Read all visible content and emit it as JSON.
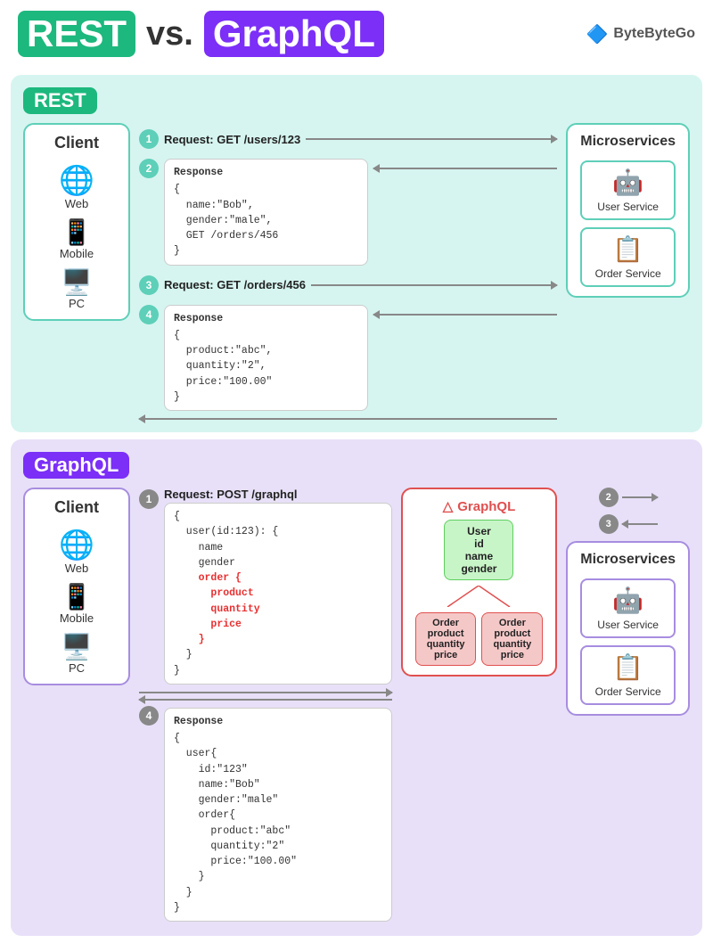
{
  "header": {
    "title_rest": "REST",
    "title_vs": "vs.",
    "title_graphql": "GraphQL",
    "brand": "ByteByteGo"
  },
  "rest": {
    "label": "REST",
    "client_title": "Client",
    "client_items": [
      "Web",
      "Mobile",
      "PC"
    ],
    "microservices_title": "Microservices",
    "services": [
      "User Service",
      "Order Service"
    ],
    "step1": "1",
    "step2": "2",
    "step3": "3",
    "step4": "4",
    "req1": "Request: GET /users/123",
    "resp2_title": "Response",
    "resp2_body": "{\n  name:\"Bob\",\n  gender:\"male\",\n  GET /orders/456\n}",
    "req3": "Request: GET /orders/456",
    "resp4_title": "Response",
    "resp4_body": "{\n  product:\"abc\",\n  quantity:\"2\",\n  price:\"100.00\"\n}"
  },
  "graphql": {
    "label": "GraphQL",
    "client_title": "Client",
    "client_items": [
      "Web",
      "Mobile",
      "PC"
    ],
    "microservices_title": "Microservices",
    "services": [
      "User Service",
      "Order Service"
    ],
    "step1": "1",
    "step2": "2",
    "step3": "3",
    "step4": "4",
    "req1": "Request: POST /graphql",
    "req1_body": "{\n  user(id:123): {\n    name\n    gender\n    order {\n      product\n      quantity\n      price\n    }\n  }\n}",
    "resp4_title": "Response",
    "resp4_body": "{\n  user{\n    id:\"123\"\n    name:\"Bob\"\n    gender:\"male\"\n    order{\n      product:\"abc\"\n      quantity:\"2\"\n      price:\"100.00\"\n    }\n  }\n}",
    "graphql_title": "GraphQL",
    "user_node": "User",
    "user_fields": "id\nname\ngender",
    "order_fields": "product\nquantity\nprice"
  }
}
